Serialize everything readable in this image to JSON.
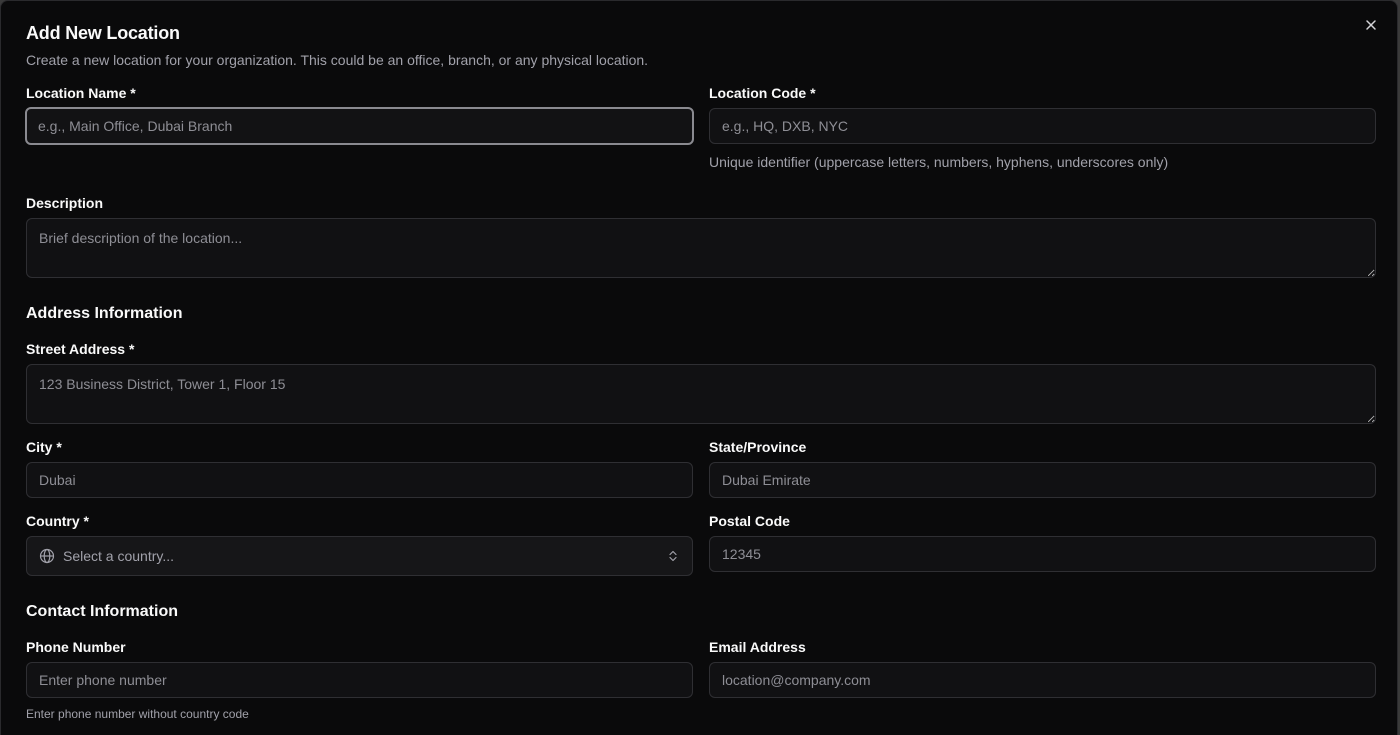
{
  "dialog": {
    "title": "Add New Location",
    "subtitle": "Create a new location for your organization. This could be an office, branch, or any physical location."
  },
  "fields": {
    "location_name": {
      "label": "Location Name *",
      "placeholder": "e.g., Main Office, Dubai Branch"
    },
    "location_code": {
      "label": "Location Code *",
      "placeholder": "e.g., HQ, DXB, NYC",
      "help": "Unique identifier (uppercase letters, numbers, hyphens, underscores only)"
    },
    "description": {
      "label": "Description",
      "placeholder": "Brief description of the location..."
    }
  },
  "address": {
    "section_title": "Address Information",
    "street": {
      "label": "Street Address *",
      "placeholder": "123 Business District, Tower 1, Floor 15"
    },
    "city": {
      "label": "City *",
      "placeholder": "Dubai"
    },
    "state": {
      "label": "State/Province",
      "placeholder": "Dubai Emirate"
    },
    "country": {
      "label": "Country *",
      "placeholder": "Select a country..."
    },
    "postal": {
      "label": "Postal Code",
      "placeholder": "12345"
    }
  },
  "contact": {
    "section_title": "Contact Information",
    "phone": {
      "label": "Phone Number",
      "placeholder": "Enter phone number",
      "help": "Enter phone number without country code"
    },
    "email": {
      "label": "Email Address",
      "placeholder": "location@company.com"
    }
  },
  "icons": {
    "close": "close-icon",
    "globe": "globe-icon",
    "chevron": "chevron-up-down-icon"
  }
}
